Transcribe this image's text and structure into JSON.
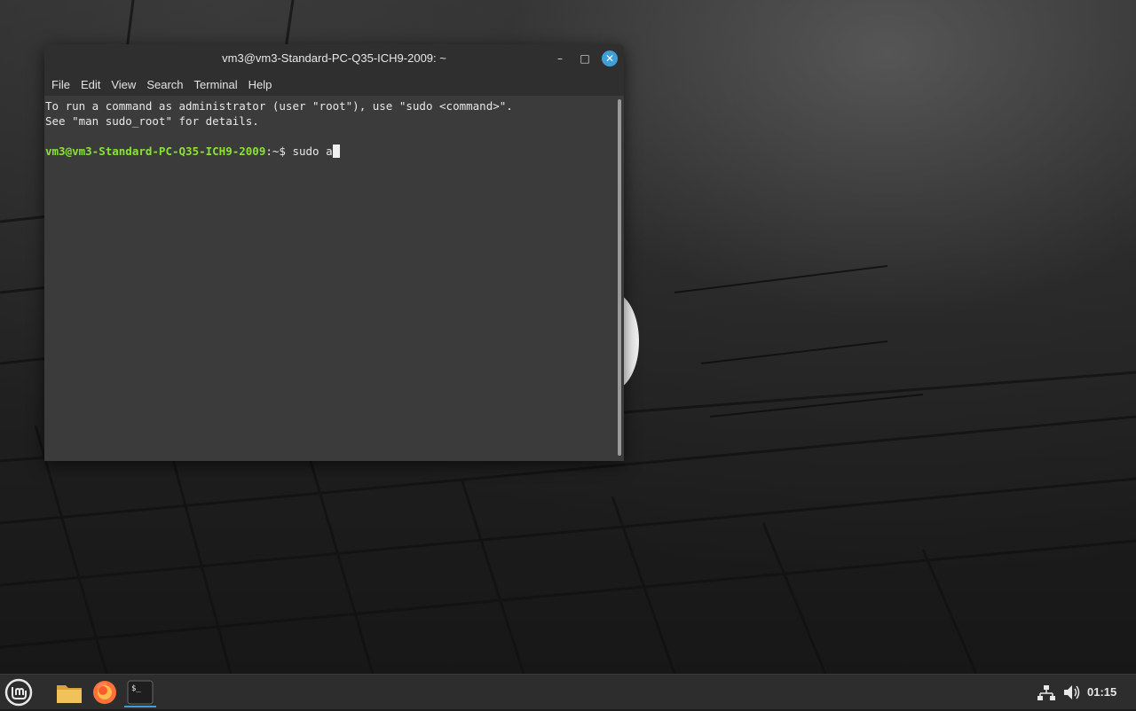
{
  "window": {
    "title": "vm3@vm3-Standard-PC-Q35-ICH9-2009: ~",
    "controls": {
      "minimize": "–",
      "maximize": "□",
      "close": "✕"
    }
  },
  "menu": [
    "File",
    "Edit",
    "View",
    "Search",
    "Terminal",
    "Help"
  ],
  "terminal": {
    "line1": "To run a command as administrator (user \"root\"), use \"sudo <command>\".",
    "line2": "See \"man sudo_root\" for details.",
    "prompt_user": "vm3@vm3-Standard-PC-Q35-ICH9-2009",
    "prompt_suffix": ":~$ ",
    "command": "sudo a"
  },
  "taskbar": {
    "apps": [
      "mint-menu-icon",
      "files-icon",
      "firefox-icon",
      "terminal-icon"
    ],
    "clock": "01:15"
  },
  "colors": {
    "accent": "#3f9fd8",
    "prompt_green": "#8ae234"
  }
}
